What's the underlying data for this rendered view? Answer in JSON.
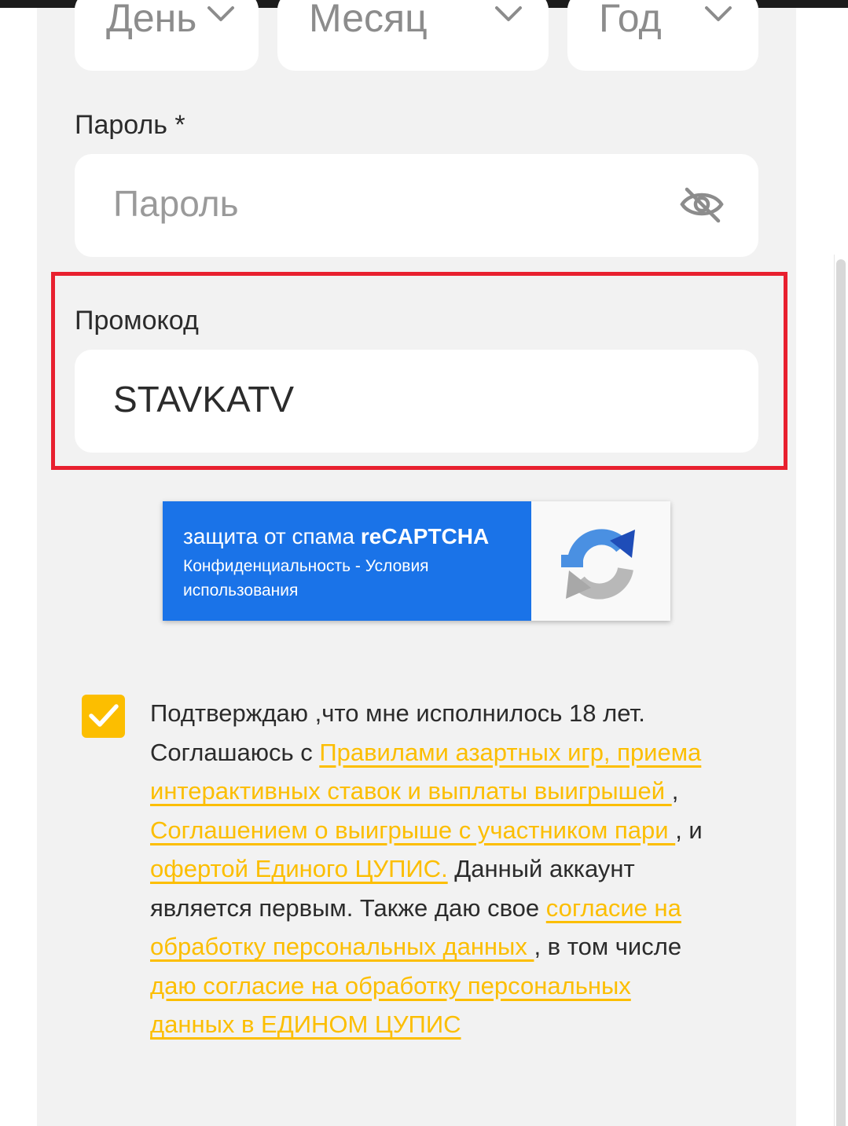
{
  "birthdate": {
    "day_placeholder": "День",
    "month_placeholder": "Месяц",
    "year_placeholder": "Год"
  },
  "password": {
    "label": "Пароль *",
    "placeholder": "Пароль"
  },
  "promo": {
    "label": "Промокод",
    "value": "STAVKATV"
  },
  "recaptcha": {
    "title_prefix": "защита от спама ",
    "title_brand": "reCAPTCHA",
    "privacy_link": "Конфиденциальность",
    "separator": " - ",
    "terms_link": "Условия использования"
  },
  "consent": {
    "checked": true,
    "t1": "Подтверждаю ,что мне исполнилось 18 лет. Соглашаюсь с ",
    "link1": "Правилами азартных игр, приема интерактивных ставок и выплаты выигрышей ",
    "t2": ", ",
    "link2": "Соглашением о выигрыше с участником пари ",
    "t3": ", и ",
    "link3": "офертой Единого ЦУПИС.",
    "t4": " Данный аккаунт является первым. Также даю свое ",
    "link4": "согласие на обработку персональных данных ",
    "t5": ", в том числе ",
    "link5": "даю согласие на обработку персональных данных в ЕДИНОМ  ЦУПИС"
  },
  "colors": {
    "accent": "#fcbe00",
    "highlight": "#e8202f",
    "recaptcha_blue": "#1a73e8"
  }
}
